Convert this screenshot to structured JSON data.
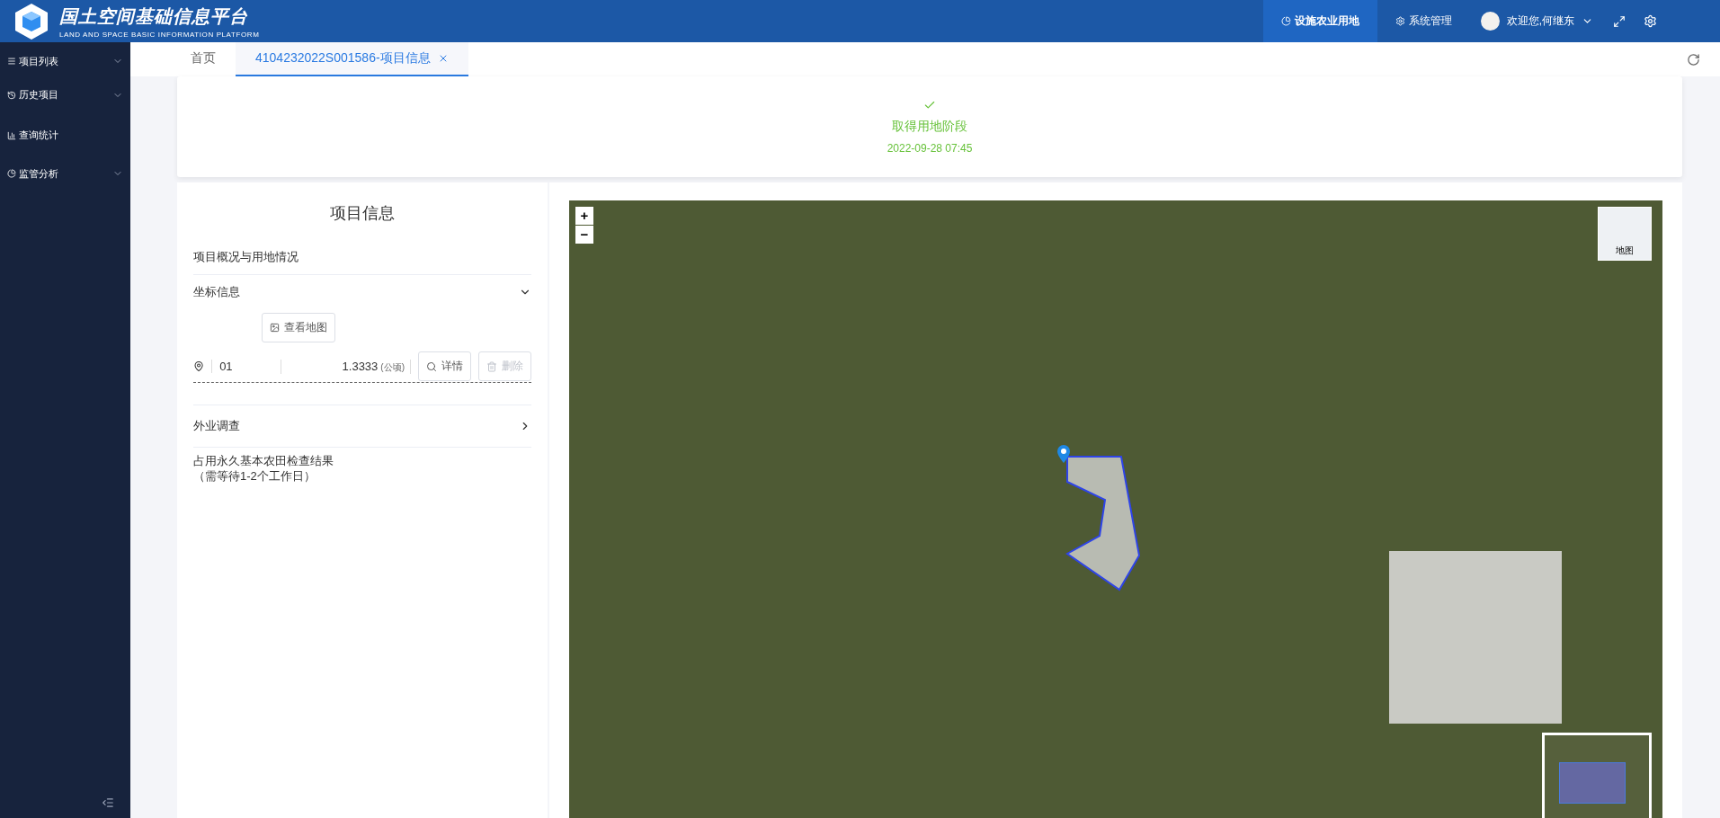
{
  "header": {
    "title": "国土空间基础信息平台",
    "subtitle": "LAND AND SPACE BASIC INFORMATION PLATFORM",
    "nav": [
      {
        "label": "设施农业用地",
        "selected": true
      },
      {
        "label": "系统管理",
        "selected": false
      }
    ],
    "user": "欢迎您,何继东"
  },
  "sidebar": {
    "items": [
      {
        "label": "项目列表",
        "expandable": true
      },
      {
        "label": "历史项目",
        "expandable": true
      },
      {
        "label": "查询统计",
        "expandable": false
      },
      {
        "label": "监管分析",
        "expandable": true
      }
    ]
  },
  "tabs": [
    {
      "label": "首页",
      "selected": false,
      "closable": false
    },
    {
      "label": "4104232022S001586-项目信息",
      "selected": true,
      "closable": true
    }
  ],
  "stage": {
    "done": true,
    "title": "取得用地阶段",
    "time": "2022-09-28 07:45"
  },
  "panel": {
    "title": "项目信息",
    "overview": "项目概况与用地情况",
    "coords": {
      "title": "坐标信息",
      "expanded": true,
      "view_map": "查看地图",
      "rows": [
        {
          "id": "01",
          "area": "1.3333",
          "unit": "(公顷)",
          "detail": "详情",
          "delete": "删除",
          "delete_disabled": true
        }
      ]
    },
    "survey": {
      "title": "外业调查",
      "expanded": false
    },
    "check": "占用永久基本农田检查结果",
    "check_note": "（需等待1-2个工作日）"
  },
  "map": {
    "zoom_in": "+",
    "zoom_out": "−",
    "layer": "地图"
  }
}
